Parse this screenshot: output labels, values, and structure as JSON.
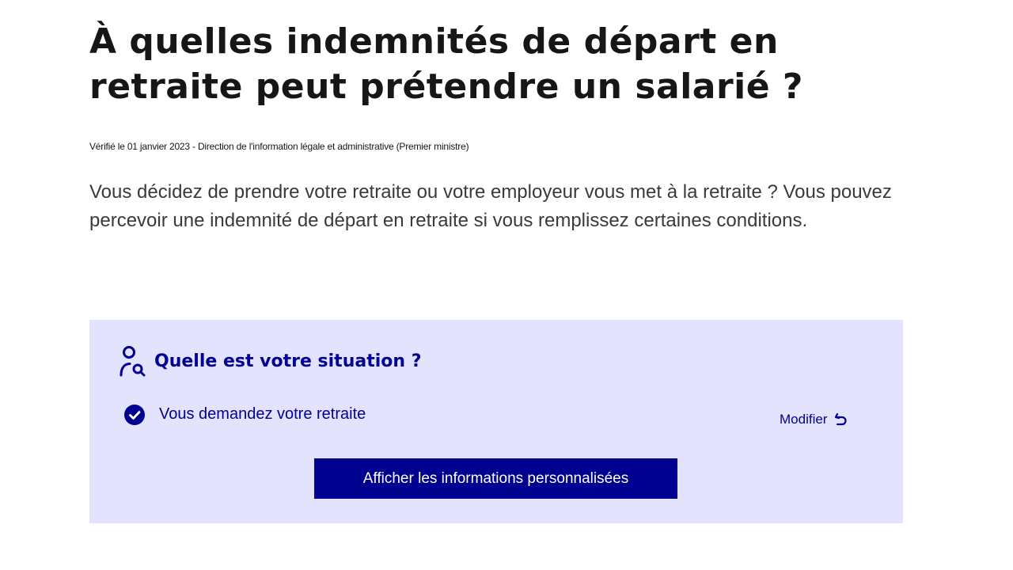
{
  "page": {
    "title": "À quelles indemnités de départ en retraite peut prétendre un salarié ?",
    "verified": "Vérifié le 01 janvier 2023 - Direction de l'information légale et administrative (Premier ministre)",
    "intro": "Vous décidez de prendre votre retraite ou votre employeur vous met à la retraite ? Vous pouvez percevoir une indemnité de départ en retraite si vous remplissez certaines conditions."
  },
  "situation": {
    "title": "Quelle est votre situation ?",
    "title_icon": "user-search-icon",
    "answer": "Vous demandez votre retraite",
    "answer_icon": "check-circle-icon",
    "modify_label": "Modifier",
    "modify_icon": "undo-arrow-icon",
    "show_button_label": "Afficher les informations personnalisées"
  },
  "colors": {
    "primary_blue": "#000091",
    "box_background": "#e3e3fd",
    "text_dark": "#161616",
    "text_body": "#3a3a3a"
  }
}
